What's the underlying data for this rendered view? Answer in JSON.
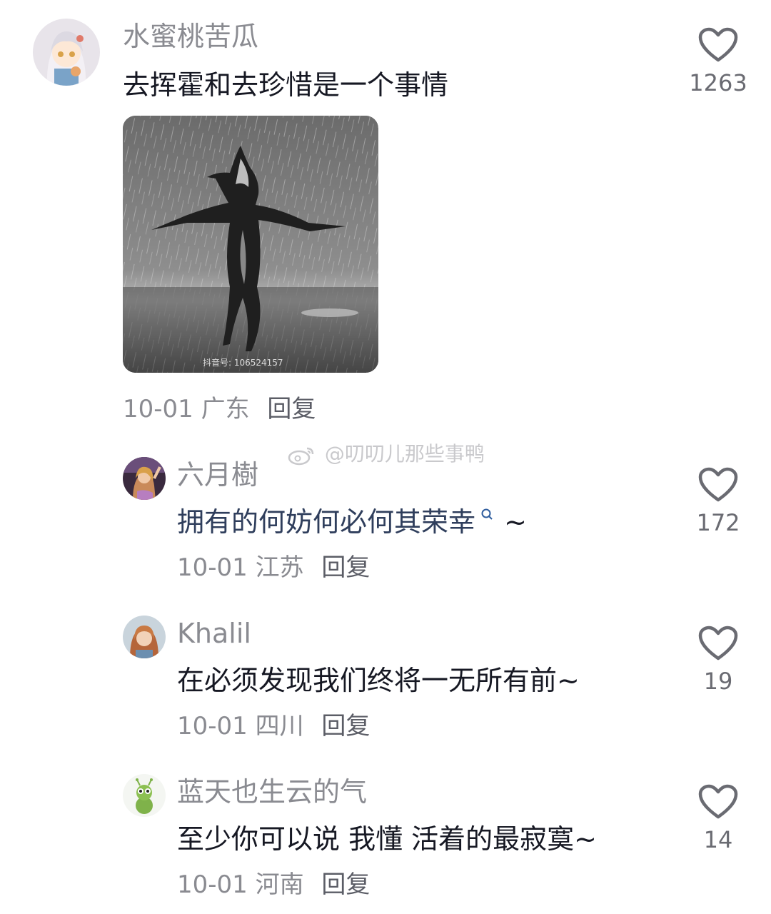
{
  "comments": [
    {
      "username": "水蜜桃苦瓜",
      "text": "去挥霍和去珍惜是一个事情",
      "date": "10-01",
      "location": "广东",
      "reply_label": "回复",
      "likes": "1263",
      "image_watermark": "抖音号: 106524157"
    },
    {
      "username": "六月樹",
      "text": "拥有的何妨何必何其荣幸",
      "text_suffix": " ~",
      "date": "10-01",
      "location": "江苏",
      "reply_label": "回复",
      "likes": "172"
    },
    {
      "username": "Khalil",
      "text": "在必须发现我们终将一无所有前~",
      "date": "10-01",
      "location": "四川",
      "reply_label": "回复",
      "likes": "19"
    },
    {
      "username": "蓝天也生云的气",
      "text": "至少你可以说 我懂 活着的最寂寞~",
      "date": "10-01",
      "location": "河南",
      "reply_label": "回复",
      "likes": "14"
    }
  ],
  "watermark": "@叨叨儿那些事鸭",
  "colors": {
    "username": "#8a8b91",
    "text": "#161823",
    "meta": "#8a8b91",
    "link_accent": "#2f5d9e"
  },
  "icons": [
    "heart-outline-icon",
    "search-icon",
    "weibo-logo-icon"
  ]
}
